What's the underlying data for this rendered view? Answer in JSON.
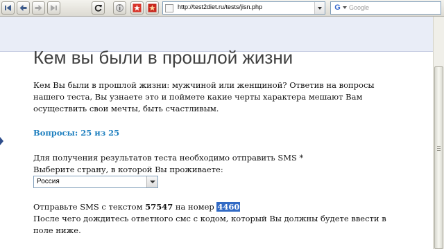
{
  "browser": {
    "url": "http://test2diet.ru/tests/jisn.php",
    "search_placeholder": "Google",
    "search_engine_letter": "G"
  },
  "page": {
    "title": "Кем вы были в прошлой жизни",
    "intro": "Кем Вы были в прошлой жизни: мужчиной или женщиной? Ответив на вопросы нашего теста, Вы узнаете это и поймете какие черты характера мешают Вам осуществить свои мечты, быть счастливым.",
    "questions_progress": "Вопросы: 25 из 25",
    "sms_required": "Для получения результатов теста необходимо отправить SMS *",
    "country_label": "Выберите страну, в которой Вы проживаете:",
    "country_selected": "Россия",
    "sms_instruction_prefix": "Отправьте SMS с текстом",
    "sms_text_code": "57547",
    "sms_instruction_middle": "на номер",
    "sms_number": "4460",
    "after_sms": "После чего дождитесь ответного смс с кодом, который Вы должны будете ввести в поле ниже."
  },
  "colors": {
    "accent_link": "#1e7fbf",
    "selection": "#316ac5"
  }
}
